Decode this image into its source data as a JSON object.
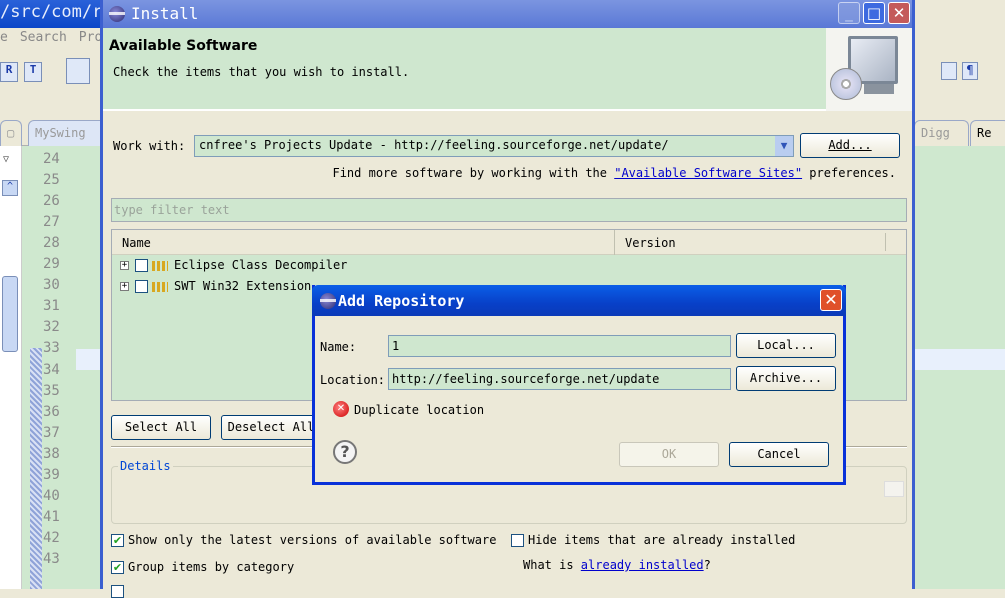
{
  "ide": {
    "title": "/src/com/ra",
    "menu": [
      "e",
      "Search",
      "Proj"
    ],
    "tab_left": "MySwing",
    "tabs_right": [
      "Digg",
      "Re"
    ],
    "line_numbers": [
      "24",
      "25",
      "26",
      "27",
      "28",
      "29",
      "30",
      "31",
      "32",
      "33",
      "34",
      "35",
      "36",
      "37",
      "38",
      "39",
      "40",
      "41",
      "42",
      "43"
    ]
  },
  "install": {
    "title": "Install",
    "header_title": "Available Software",
    "header_subtitle": "Check the items that you wish to install.",
    "work_with_label": "Work with:",
    "work_with_value": "cnfree's Projects Update - http://feeling.sourceforge.net/update/",
    "add_button": "Add...",
    "find_more_prefix": "Find more software by working with the ",
    "find_more_link": "\"Available Software Sites\"",
    "find_more_suffix": " preferences.",
    "filter_placeholder": "type filter text",
    "columns": [
      "Name",
      "Version"
    ],
    "items": [
      {
        "name": "Eclipse Class Decompiler",
        "checked": false
      },
      {
        "name": "SWT Win32 Extension",
        "checked": false
      }
    ],
    "select_all": "Select All",
    "deselect_all": "Deselect All",
    "details_label": "Details",
    "options": {
      "show_latest": {
        "label": "Show only the latest versions of available software",
        "checked": true
      },
      "group_by_category": {
        "label": "Group items by category",
        "checked": true
      },
      "hide_installed": {
        "label": "Hide items that are already installed",
        "checked": false
      }
    },
    "what_is_prefix": "What is ",
    "what_is_link": "already installed",
    "what_is_suffix": "?"
  },
  "add_repository": {
    "title": "Add Repository",
    "name_label": "Name:",
    "name_value": "1",
    "location_label": "Location:",
    "location_value": "http://feeling.sourceforge.net/update",
    "local_button": "Local...",
    "archive_button": "Archive...",
    "error_message": "Duplicate location",
    "ok_button": "OK",
    "cancel_button": "Cancel"
  },
  "colors": {
    "title_blue": "#0a46c8",
    "field_green": "#cfe7cf",
    "dialog_bg": "#ece9d8",
    "error_red": "#cc0000",
    "link": "#0000cc"
  }
}
